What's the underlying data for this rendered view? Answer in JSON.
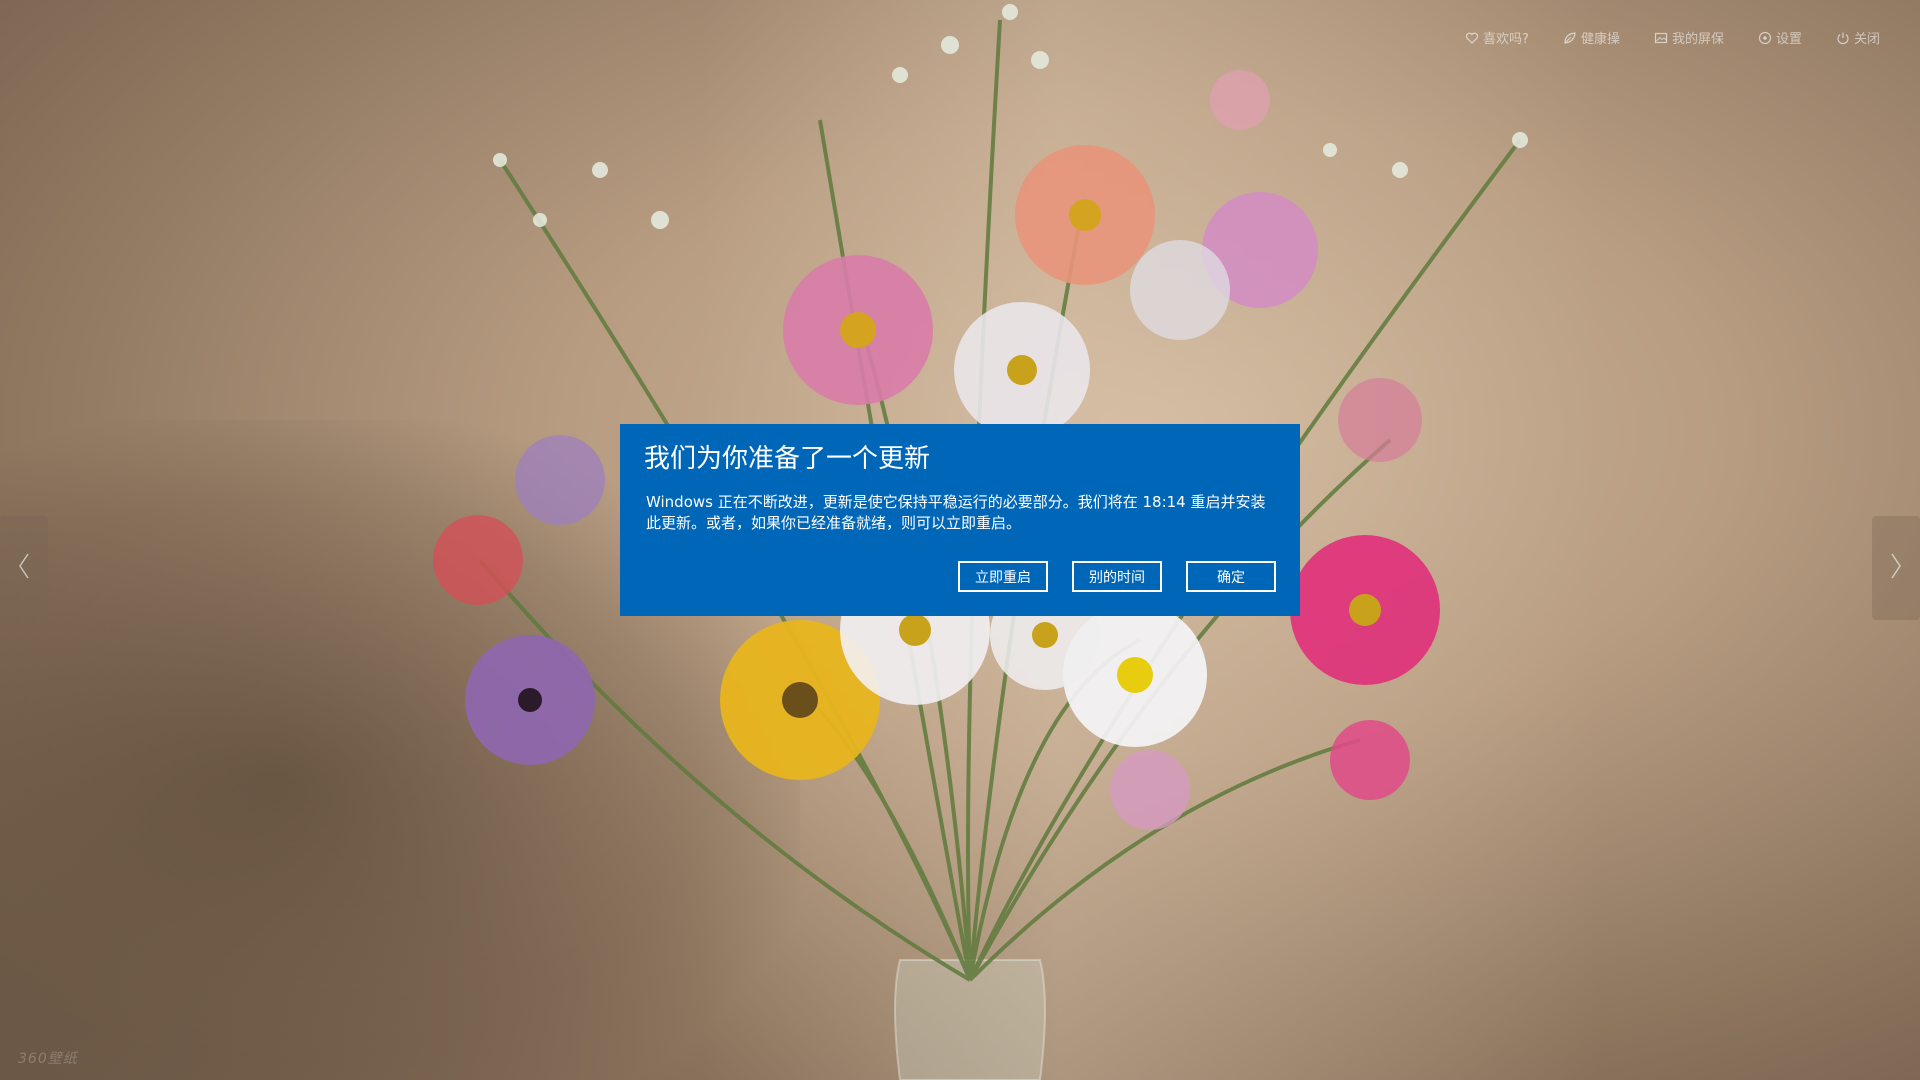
{
  "toolbar": {
    "items": [
      {
        "label": "喜欢吗?",
        "icon": "heart-icon"
      },
      {
        "label": "健康操",
        "icon": "leaf-icon"
      },
      {
        "label": "我的屏保",
        "icon": "image-icon"
      },
      {
        "label": "设置",
        "icon": "settings-icon"
      },
      {
        "label": "关闭",
        "icon": "power-icon"
      }
    ]
  },
  "dialog": {
    "title": "我们为你准备了一个更新",
    "body": "Windows 正在不断改进，更新是使它保持平稳运行的必要部分。我们将在 18:14 重启并安装此更新。或者，如果你已经准备就绪，则可以立即重启。",
    "buttons": {
      "restart_now": "立即重启",
      "other_time": "别的时间",
      "ok": "确定"
    },
    "accent_color": "#0067b8"
  },
  "watermark": "360壁纸",
  "navigation": {
    "prev_icon": "chevron-left-icon",
    "next_icon": "chevron-right-icon"
  }
}
